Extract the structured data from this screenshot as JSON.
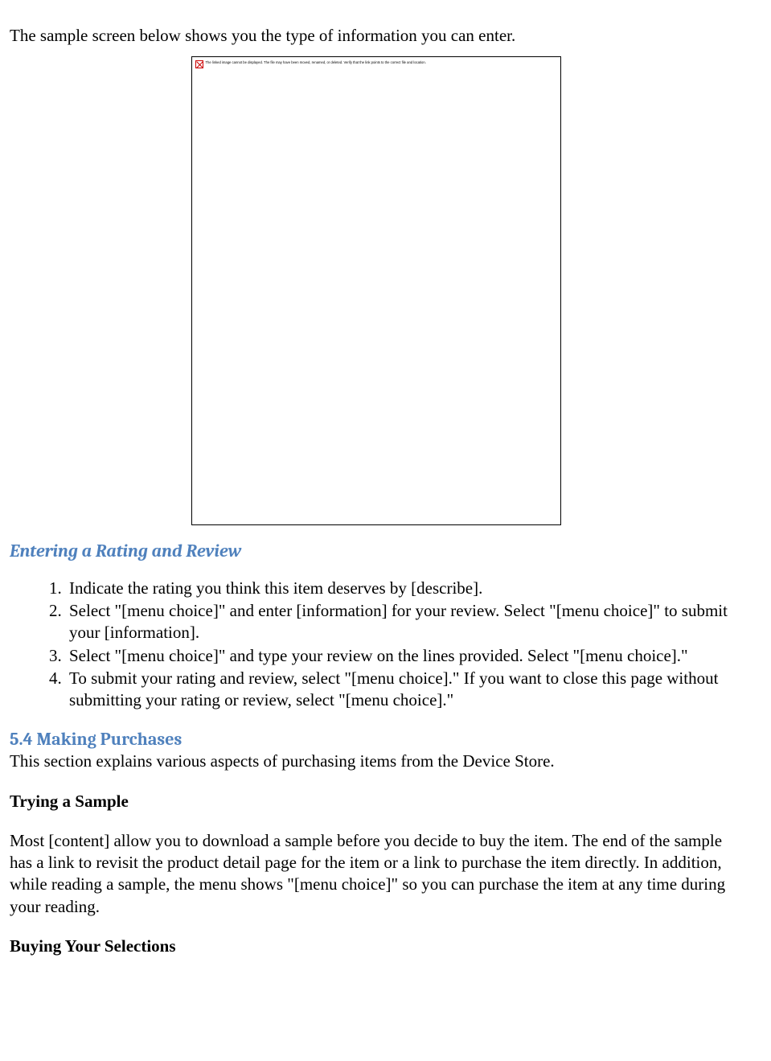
{
  "intro": "The sample screen below shows you the type of information you can enter.",
  "placeholder_error": "The linked image cannot be displayed. The file may have been moved, renamed, or deleted. Verify that the link points to the correct file and location.",
  "heading_rating": "Entering a Rating and Review",
  "list": {
    "item1": "Indicate the rating you think this item deserves by [describe].",
    "item2": "Select \"[menu choice]\" and enter [information] for your review. Select \"[menu choice]\" to submit your [information].",
    "item3": "Select \"[menu choice]\" and type your review on the lines provided. Select \"[menu choice].\"",
    "item4": "To submit your rating and review, select \"[menu choice].\" If you want to close this page without submitting your rating or review, select \"[menu choice].\""
  },
  "heading_purchases": "5.4 Making Purchases",
  "purchases_intro": "This section explains various aspects of purchasing items from the Device Store.",
  "heading_trying": "Trying a Sample",
  "trying_body": "Most [content] allow you to download a sample before you decide to buy the item. The end of the sample has a link to revisit the product detail page for the item or a link to purchase the item directly. In addition, while reading a sample, the menu shows \"[menu choice]\" so you can purchase the item at any time during your reading.",
  "heading_buying": "Buying Your Selections"
}
